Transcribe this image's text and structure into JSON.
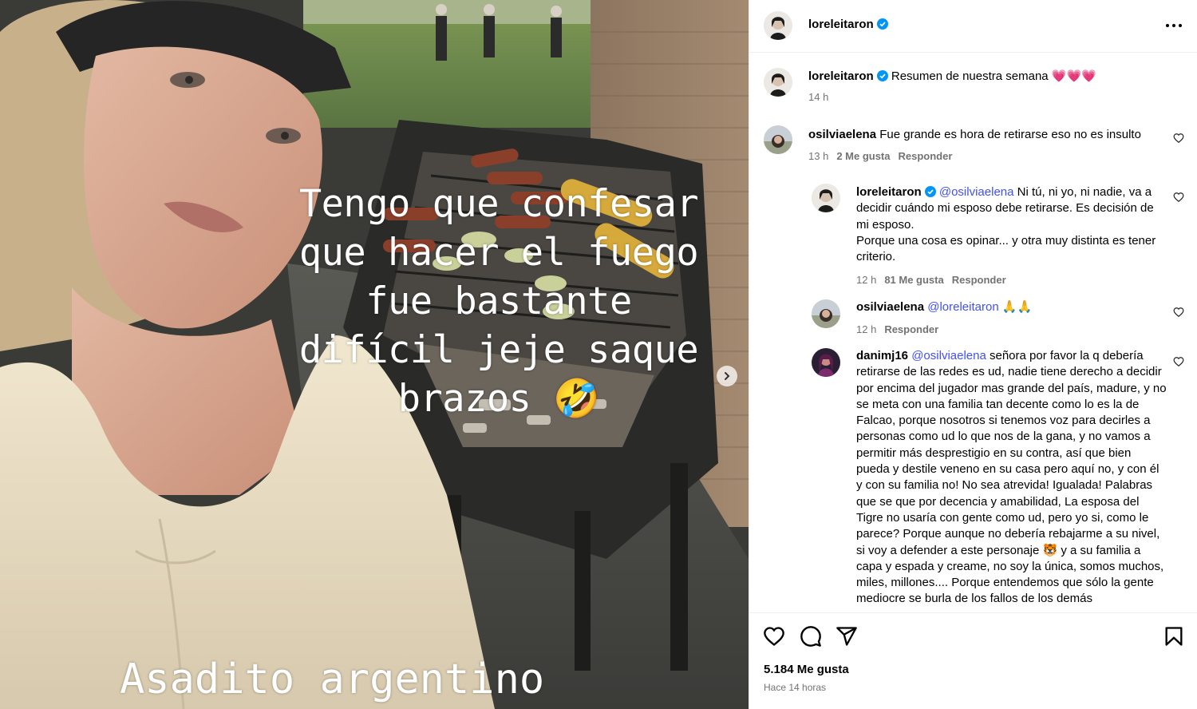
{
  "media": {
    "story_lines": [
      "Tengo que confesar",
      "que hacer el fuego",
      "fue bastante",
      "difícil jeje saque",
      "brazos 🤣"
    ],
    "caption_bottom": "Asadito argentino",
    "next_icon": "chevron-right-icon"
  },
  "post": {
    "author": "loreleitaron",
    "verified": true,
    "more_icon": "more-horizontal-icon"
  },
  "caption": {
    "user": "loreleitaron",
    "text": "Resumen de nuestra semana 💗💗💗",
    "time": "14 h"
  },
  "comments": [
    {
      "user": "osilviaelena",
      "text": "Fue grande es hora de retirarse eso no es insulto",
      "time": "13 h",
      "likes": "2 Me gusta",
      "reply": "Responder"
    },
    {
      "user": "loreleitaron",
      "mention": "@osilviaelena",
      "text": " Ni tú, ni yo, ni nadie, va a decidir cuándo mi esposo debe retirarse. Es decisión de mi esposo.",
      "text2": "Porque una cosa es opinar... y otra muy distinta es tener criterio.",
      "time": "12 h",
      "likes": "81 Me gusta",
      "reply": "Responder"
    },
    {
      "user": "osilviaelena",
      "mention": "@loreleitaron",
      "text": " 🙏🙏",
      "time": "12 h",
      "reply": "Responder"
    },
    {
      "user": "danimj16",
      "mention": "@osilviaelena",
      "text": " señora por favor la q debería retirarse de las redes es ud, nadie tiene derecho a decidir por encima del jugador mas grande del país, madure, y no se meta con una familia tan decente como lo es la de Falcao, porque nosotros si tenemos voz para decirles a personas como ud lo que nos de la gana, y no vamos a permitir más desprestigio en su contra, así que bien pueda y destile veneno en su casa pero aquí no, y con él y con su familia no! No sea atrevida! Igualada! Palabras que se que por decencia y amabilidad, La esposa del Tigre no usaría con gente como ud, pero yo si, como le parece? Porque aunque no debería rebajarme a su nivel, si voy a defender a este personaje 🐯 y a su familia a capa y espada y creame, no soy la única, somos muchos, miles, millones.... Porque entendemos que sólo la gente mediocre se burla de los fallos de los demás"
    }
  ],
  "actions": {
    "like_icon": "heart-icon",
    "comment_icon": "comment-icon",
    "share_icon": "send-icon",
    "save_icon": "bookmark-icon",
    "likes": "5.184 Me gusta",
    "posted": "Hace 14 horas"
  },
  "colors": {
    "link": "#4150f7",
    "verified": "#0095f6",
    "muted": "#737373",
    "divider": "#efefef"
  }
}
